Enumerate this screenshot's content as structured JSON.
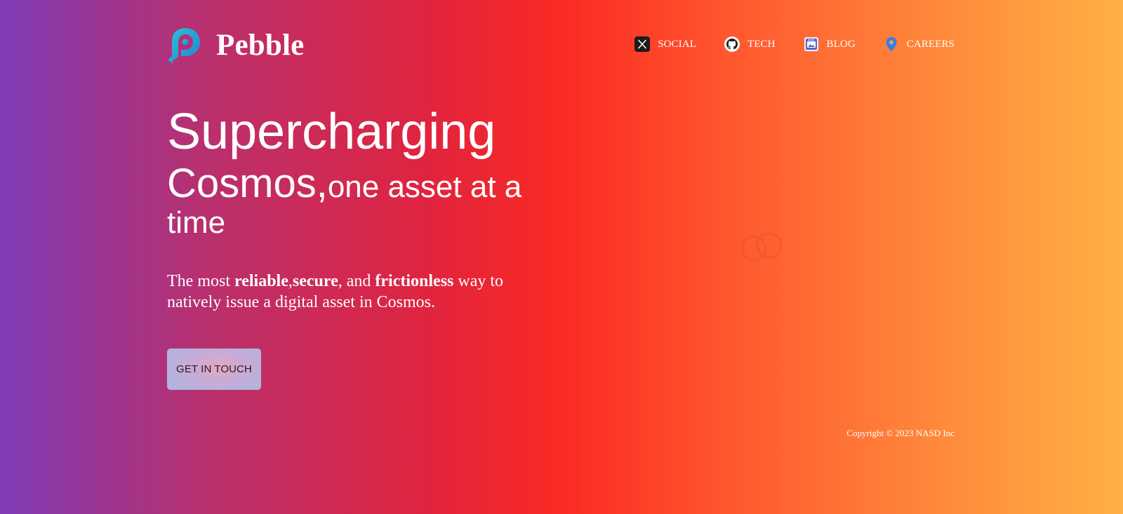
{
  "brand": {
    "name": "Pebble",
    "logo_icon": "pebble-p-logo",
    "logo_colors": [
      "#1fb6d6",
      "#2b8fd0"
    ]
  },
  "nav": {
    "items": [
      {
        "label": "SOCIAL",
        "icon": "x-twitter-icon"
      },
      {
        "label": "TECH",
        "icon": "github-icon"
      },
      {
        "label": "BLOG",
        "icon": "blog-icon"
      },
      {
        "label": "CAREERS",
        "icon": "location-pin-icon"
      }
    ]
  },
  "hero": {
    "line1": "Supercharging",
    "line2_big": "Cosmos,",
    "line2_small": "one asset at a time"
  },
  "subtext": {
    "prefix": "The most ",
    "word1": "reliable",
    "sep1": ",",
    "word2": "secure",
    "sep2": ", and ",
    "word3": "frictionless",
    "suffix": " way to natively issue a digital asset in Cosmos."
  },
  "cta": {
    "label": "GET IN TOUCH"
  },
  "footer": {
    "copyright": "Copyright © 2023 NASD Inc"
  },
  "colors": {
    "gradient_start": "#7f3bb6",
    "gradient_mid": "#fb2a23",
    "gradient_end": "#ffb046",
    "text": "#ffffff"
  }
}
